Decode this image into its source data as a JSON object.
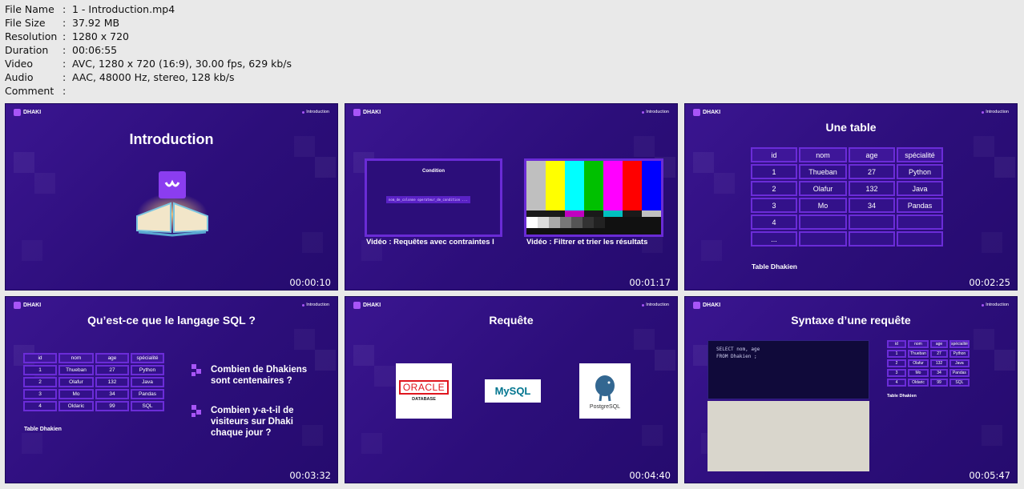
{
  "meta": [
    {
      "key": "File Name",
      "value": "1 - Introduction.mp4"
    },
    {
      "key": "File Size",
      "value": "37.92 MB"
    },
    {
      "key": "Resolution",
      "value": "1280 x 720"
    },
    {
      "key": "Duration",
      "value": "00:06:55"
    },
    {
      "key": "Video",
      "value": "AVC, 1280 x 720 (16:9), 30.00 fps, 629 kb/s"
    },
    {
      "key": "Audio",
      "value": "AAC, 48000 Hz, stereo, 128 kb/s"
    },
    {
      "key": "Comment",
      "value": ""
    }
  ],
  "brand": "DHAKI",
  "crumb": "Introduction",
  "colors": {
    "slide_bg": "#2c0e7a",
    "accent": "#a855f7",
    "border": "#6a2bd6"
  },
  "thumbs": [
    {
      "timestamp": "00:00:10",
      "title": "Introduction"
    },
    {
      "timestamp": "00:01:17",
      "mini_title": "Condition",
      "mini_code": "nom_de_colonne operateur_de_condition ...",
      "caption_left": "Vidéo : Requêtes avec contraintes l",
      "caption_right": "Vidéo : Filtrer et trier les résultats"
    },
    {
      "timestamp": "00:02:25",
      "title": "Une table",
      "caption": "Table Dhakien",
      "headers": [
        "id",
        "nom",
        "age",
        "spécialité"
      ],
      "rows": [
        [
          "1",
          "Thueban",
          "27",
          "Python"
        ],
        [
          "2",
          "Olafur",
          "132",
          "Java"
        ],
        [
          "3",
          "Mo",
          "34",
          "Pandas"
        ],
        [
          "4",
          "",
          "",
          ""
        ],
        [
          "...",
          "",
          "",
          ""
        ]
      ]
    },
    {
      "timestamp": "00:03:32",
      "title": "Qu’est-ce que le langage SQL ?",
      "caption": "Table Dhakien",
      "headers": [
        "id",
        "nom",
        "age",
        "spécialité"
      ],
      "rows": [
        [
          "1",
          "Thueban",
          "27",
          "Python"
        ],
        [
          "2",
          "Olafur",
          "132",
          "Java"
        ],
        [
          "3",
          "Mo",
          "34",
          "Pandas"
        ],
        [
          "4",
          "Oldaric",
          "99",
          "SQL"
        ]
      ],
      "bullets": [
        "Combien de Dhakiens sont centenaires ?",
        "Combien y-a-t-il de visiteurs sur Dhaki chaque jour ?"
      ]
    },
    {
      "timestamp": "00:04:40",
      "title": "Requête",
      "logos": {
        "oracle": "ORACLE",
        "oracle_sub": "DATABASE",
        "mysql": "MySQL",
        "postgres": "PostgreSQL"
      }
    },
    {
      "timestamp": "00:05:47",
      "title": "Syntaxe d’une requête",
      "caption": "Table Dhakien",
      "code": "SELECT nom, age\nFROM Dhakien ;",
      "headers": [
        "id",
        "nom",
        "age",
        "spécialité"
      ],
      "rows": [
        [
          "1",
          "Thueban",
          "27",
          "Python"
        ],
        [
          "2",
          "Olafur",
          "132",
          "Java"
        ],
        [
          "3",
          "Mo",
          "34",
          "Pandas"
        ],
        [
          "4",
          "Oldaric",
          "99",
          "SQL"
        ]
      ]
    }
  ]
}
